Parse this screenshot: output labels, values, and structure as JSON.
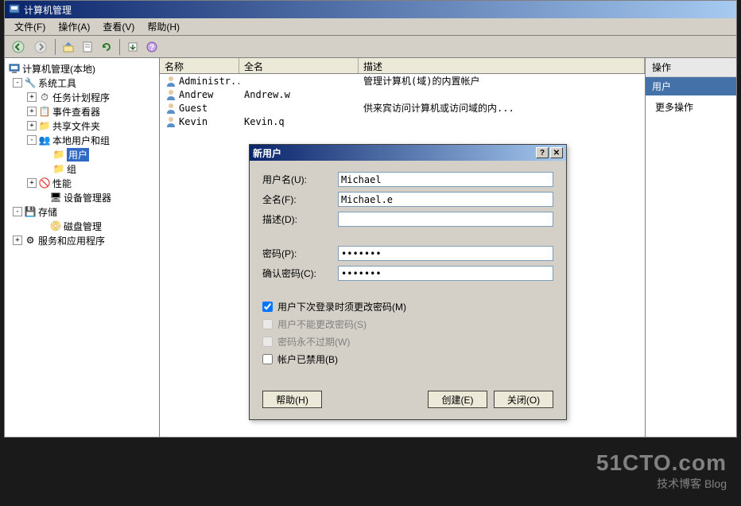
{
  "window": {
    "title": "计算机管理"
  },
  "menubar": {
    "file": "文件(F)",
    "action": "操作(A)",
    "view": "查看(V)",
    "help": "帮助(H)"
  },
  "tree": {
    "root": "计算机管理(本地)",
    "system_tools": "系统工具",
    "task_scheduler": "任务计划程序",
    "event_viewer": "事件查看器",
    "shared_folders": "共享文件夹",
    "local_users_groups": "本地用户和组",
    "users": "用户",
    "groups": "组",
    "performance": "性能",
    "device_manager": "设备管理器",
    "storage": "存储",
    "disk_management": "磁盘管理",
    "services_apps": "服务和应用程序"
  },
  "list": {
    "columns": {
      "name": "名称",
      "fullname": "全名",
      "description": "描述"
    },
    "rows": [
      {
        "name": "Administr...",
        "fullname": "",
        "description": "管理计算机(域)的内置帐户"
      },
      {
        "name": "Andrew",
        "fullname": "Andrew.w",
        "description": ""
      },
      {
        "name": "Guest",
        "fullname": "",
        "description": "供来宾访问计算机或访问域的内..."
      },
      {
        "name": "Kevin",
        "fullname": "Kevin.q",
        "description": ""
      }
    ]
  },
  "actions": {
    "header": "操作",
    "subheader": "用户",
    "more": "更多操作"
  },
  "dialog": {
    "title": "新用户",
    "labels": {
      "username": "用户名(U):",
      "fullname": "全名(F):",
      "description": "描述(D):",
      "password": "密码(P):",
      "confirm": "确认密码(C):"
    },
    "values": {
      "username": "Michael",
      "fullname": "Michael.e",
      "description": "",
      "password": "•••••••",
      "confirm": "•••••••"
    },
    "checks": {
      "must_change": "用户下次登录时须更改密码(M)",
      "cannot_change": "用户不能更改密码(S)",
      "never_expires": "密码永不过期(W)",
      "disabled": "帐户已禁用(B)"
    },
    "buttons": {
      "help": "帮助(H)",
      "create": "创建(E)",
      "close": "关闭(O)"
    }
  },
  "watermark": {
    "line1": "51CTO.com",
    "line2": "技术博客  Blog"
  }
}
